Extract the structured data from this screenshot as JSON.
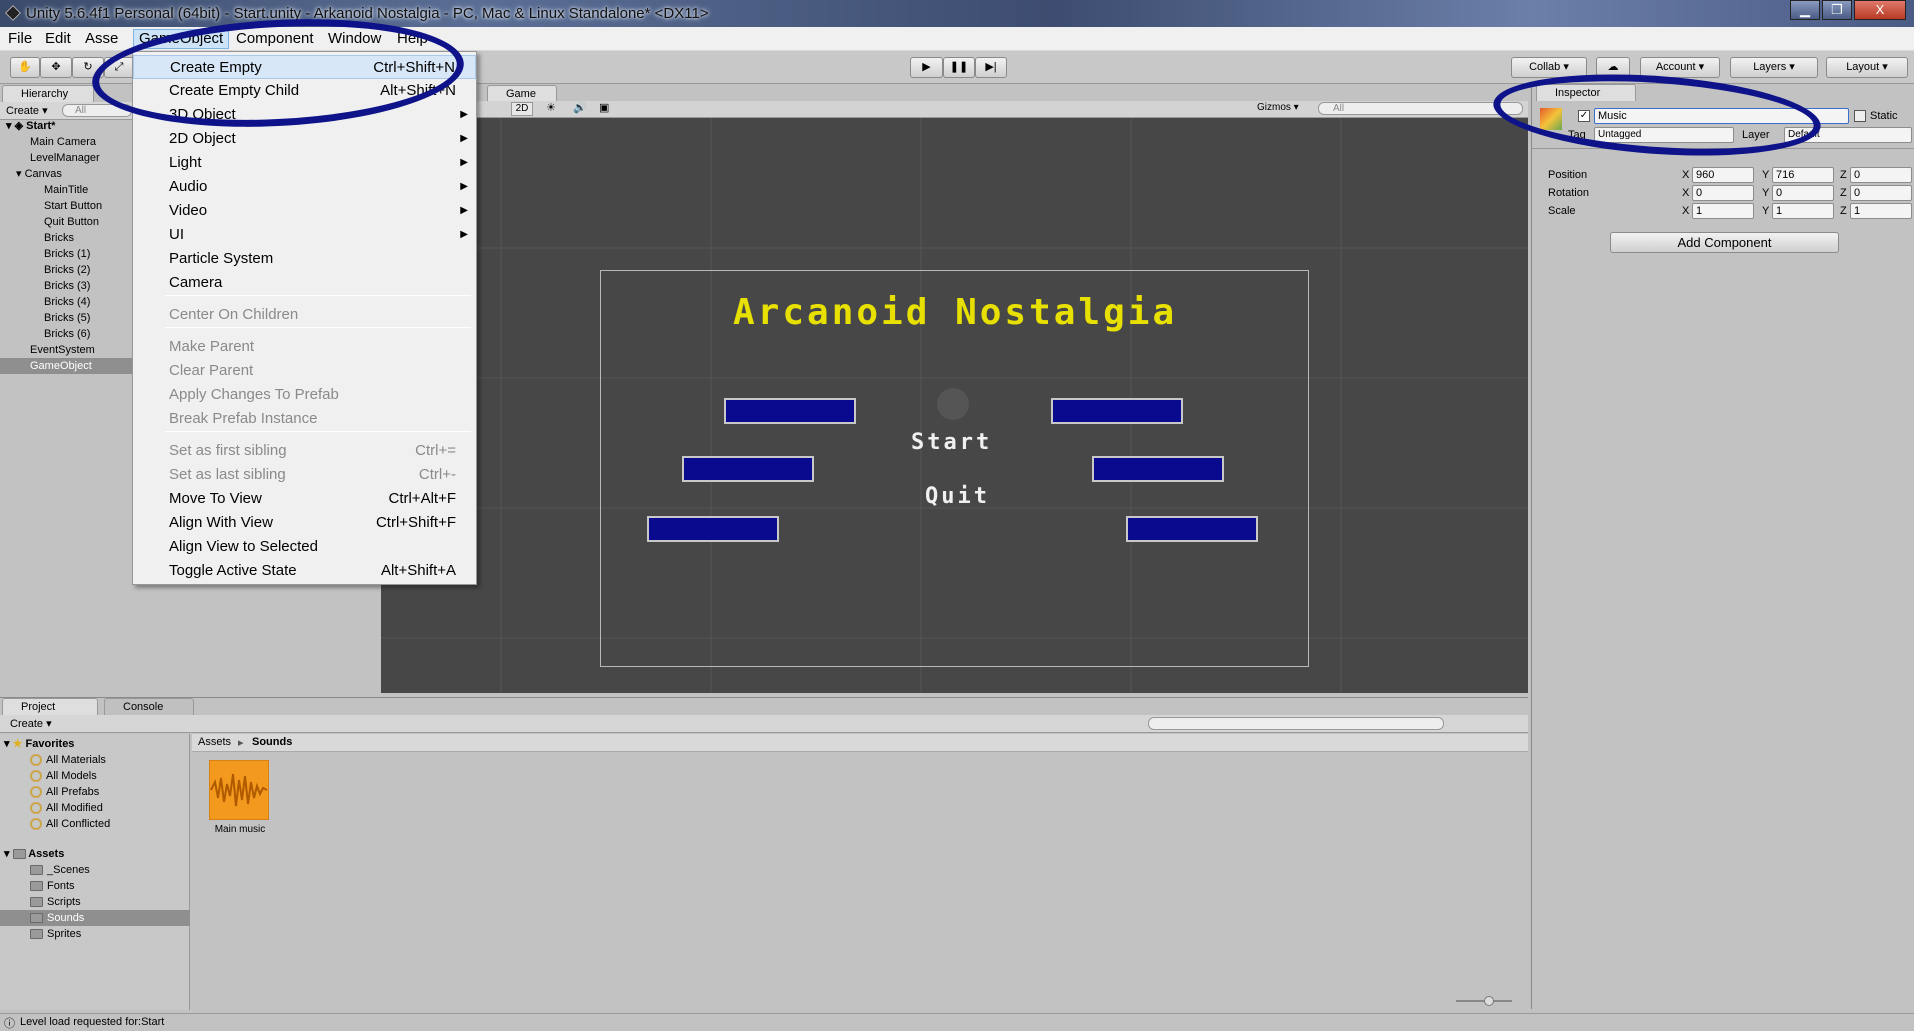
{
  "window": {
    "title": "Unity 5.6.4f1 Personal (64bit) - Start.unity - Arkanoid Nostalgia - PC, Mac & Linux Standalone* <DX11>",
    "minimize": "▁",
    "maximize": "❐",
    "close": "X"
  },
  "menubar": {
    "items": [
      "File",
      "Edit",
      "Assets",
      "GameObject",
      "Component",
      "Window",
      "Help"
    ],
    "visible_labels": [
      "File",
      "Edit",
      "Asse",
      "GameObject",
      "Component",
      "Window",
      "Help"
    ]
  },
  "gameobject_menu": {
    "items": [
      {
        "label": "Create Empty",
        "shortcut": "Ctrl+Shift+N"
      },
      {
        "label": "Create Empty Child",
        "shortcut": "Alt+Shift+N"
      },
      {
        "label": "3D Object",
        "submenu": true
      },
      {
        "label": "2D Object",
        "submenu": true
      },
      {
        "label": "Light",
        "submenu": true
      },
      {
        "label": "Audio",
        "submenu": true
      },
      {
        "label": "Video",
        "submenu": true
      },
      {
        "label": "UI",
        "submenu": true
      },
      {
        "label": "Particle System"
      },
      {
        "label": "Camera"
      },
      {
        "label": "Center On Children",
        "disabled": true
      },
      {
        "label": "Make Parent",
        "disabled": true
      },
      {
        "label": "Clear Parent",
        "disabled": true
      },
      {
        "label": "Apply Changes To Prefab",
        "disabled": true
      },
      {
        "label": "Break Prefab Instance",
        "disabled": true
      },
      {
        "label": "Set as first sibling",
        "shortcut": "Ctrl+=",
        "disabled": true
      },
      {
        "label": "Set as last sibling",
        "shortcut": "Ctrl+-",
        "disabled": true
      },
      {
        "label": "Move To View",
        "shortcut": "Ctrl+Alt+F"
      },
      {
        "label": "Align With View",
        "shortcut": "Ctrl+Shift+F"
      },
      {
        "label": "Align View to Selected"
      },
      {
        "label": "Toggle Active State",
        "shortcut": "Alt+Shift+A"
      }
    ]
  },
  "toolbar": {
    "collab": "Collab ▾",
    "account": "Account",
    "layers": "Layers",
    "layout": "Layout"
  },
  "hierarchy": {
    "tab": "Hierarchy",
    "create": "Create",
    "search_placeholder": "All",
    "scene": "Start*",
    "items": [
      {
        "label": "Main Camera",
        "indent": 1
      },
      {
        "label": "LevelManager",
        "indent": 1
      },
      {
        "label": "Canvas",
        "indent": 1,
        "expanded": true
      },
      {
        "label": "MainTitle",
        "indent": 2
      },
      {
        "label": "Start Button",
        "indent": 2
      },
      {
        "label": "Quit Button",
        "indent": 2
      },
      {
        "label": "Bricks",
        "indent": 2
      },
      {
        "label": "Bricks (1)",
        "indent": 2
      },
      {
        "label": "Bricks (2)",
        "indent": 2
      },
      {
        "label": "Bricks (3)",
        "indent": 2
      },
      {
        "label": "Bricks (4)",
        "indent": 2
      },
      {
        "label": "Bricks (5)",
        "indent": 2
      },
      {
        "label": "Bricks (6)",
        "indent": 2
      },
      {
        "label": "EventSystem",
        "indent": 1
      },
      {
        "label": "GameObject",
        "indent": 1,
        "selected": true
      }
    ]
  },
  "game": {
    "tab": "Game",
    "twod": "2D",
    "gizmos": "Gizmos",
    "search_placeholder": "All",
    "title": "Arcanoid Nostalgia",
    "start": "Start",
    "quit": "Quit",
    "title_color": "#e8e000",
    "brick_color": "#0a0a8f"
  },
  "inspector": {
    "tab": "Inspector",
    "name_value": "Music",
    "static": "Static",
    "tag_label": "Tag",
    "tag_value": "Untagged",
    "layer_label": "Layer",
    "layer_value": "Default",
    "transform": {
      "position": {
        "label": "Position",
        "x": "960",
        "y": "716",
        "z": "0"
      },
      "rotation": {
        "label": "Rotation",
        "x": "0",
        "y": "0",
        "z": "0"
      },
      "scale": {
        "label": "Scale",
        "x": "1",
        "y": "1",
        "z": "1"
      }
    },
    "add_component": "Add Component"
  },
  "project": {
    "tab": "Project",
    "console_tab": "Console",
    "create": "Create",
    "favorites": "Favorites",
    "favorite_items": [
      "All Materials",
      "All Models",
      "All Prefabs",
      "All Modified",
      "All Conflicted"
    ],
    "assets": "Assets",
    "asset_folders": [
      "_Scenes",
      "Fonts",
      "Scripts",
      "Sounds",
      "Sprites"
    ],
    "selected_folder": "Sounds",
    "breadcrumb": [
      "Assets",
      "Sounds"
    ],
    "files": [
      {
        "name": "Main music",
        "icon": "audio-file-icon"
      }
    ]
  },
  "status": {
    "message": "Level load requested for:Start"
  }
}
